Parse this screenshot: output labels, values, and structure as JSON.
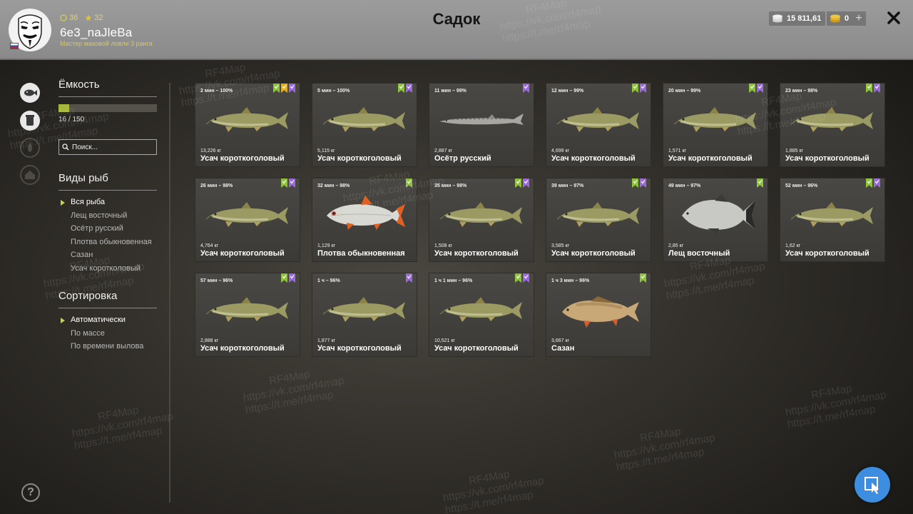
{
  "header": {
    "title": "Садок",
    "username": "6e3_naJleBa",
    "rank": "Мастер маховой ловли 3 ранга",
    "level": "36",
    "stars": "32",
    "silver": "15 811,61",
    "gold": "0",
    "plus_label": "+"
  },
  "side": {
    "capacity_title": "Ёмкость",
    "capacity_text": "16 / 150",
    "capacity_fraction": 0.107,
    "search_placeholder": "Поиск...",
    "species_title": "Виды рыб",
    "species": [
      "Вся рыба",
      "Лещ восточный",
      "Осётр русский",
      "Плотва обыкновенная",
      "Сазан",
      "Усач коротколовый"
    ],
    "sort_title": "Сортировка",
    "sort": [
      "Автоматически",
      "По массе",
      "По времени вылова"
    ],
    "help": "?"
  },
  "cards": [
    {
      "time": "2 мин – 100%",
      "weight": "13,226 кг",
      "name": "Усач короткоголовый",
      "fish": "barbel",
      "badges": [
        "green",
        "gold",
        "purple"
      ]
    },
    {
      "time": "5 мин – 100%",
      "weight": "5,115 кг",
      "name": "Усач короткоголовый",
      "fish": "barbel",
      "badges": [
        "green",
        "purple"
      ]
    },
    {
      "time": "11 мин – 99%",
      "weight": "2,887 кг",
      "name": "Осётр русский",
      "fish": "sturgeon",
      "badges": [
        "purple"
      ]
    },
    {
      "time": "12 мин – 99%",
      "weight": "4,699 кг",
      "name": "Усач короткоголовый",
      "fish": "barbel",
      "badges": [
        "green",
        "purple"
      ]
    },
    {
      "time": "20 мин – 99%",
      "weight": "1,571 кг",
      "name": "Усач короткоголовый",
      "fish": "barbel",
      "badges": [
        "green",
        "purple"
      ]
    },
    {
      "time": "23 мин – 98%",
      "weight": "1,885 кг",
      "name": "Усач короткоголовый",
      "fish": "barbel",
      "badges": [
        "green",
        "purple"
      ]
    },
    {
      "time": "26 мин – 98%",
      "weight": "4,764 кг",
      "name": "Усач короткоголовый",
      "fish": "barbel",
      "badges": [
        "green",
        "purple"
      ]
    },
    {
      "time": "32 мин – 98%",
      "weight": "1,129 кг",
      "name": "Плотва обыкновенная",
      "fish": "roach",
      "badges": [
        "green"
      ]
    },
    {
      "time": "35 мин – 98%",
      "weight": "1,508 кг",
      "name": "Усач короткоголовый",
      "fish": "barbel",
      "badges": [
        "green",
        "purple"
      ]
    },
    {
      "time": "39 мин – 97%",
      "weight": "3,585 кг",
      "name": "Усач короткоголовый",
      "fish": "barbel",
      "badges": [
        "green",
        "purple"
      ]
    },
    {
      "time": "49 мин – 97%",
      "weight": "2,85 кг",
      "name": "Лещ восточный",
      "fish": "bream",
      "badges": [
        "green"
      ]
    },
    {
      "time": "52 мин – 96%",
      "weight": "1,62 кг",
      "name": "Усач короткоголовый",
      "fish": "barbel",
      "badges": [
        "green",
        "purple"
      ]
    },
    {
      "time": "57 мин – 96%",
      "weight": "2,888 кг",
      "name": "Усач короткоголовый",
      "fish": "barbel",
      "badges": [
        "green",
        "purple"
      ]
    },
    {
      "time": "1 ч – 96%",
      "weight": "1,877 кг",
      "name": "Усач короткоголовый",
      "fish": "barbel",
      "badges": [
        "purple"
      ]
    },
    {
      "time": "1 ч 1 мин – 96%",
      "weight": "10,521 кг",
      "name": "Усач короткоголовый",
      "fish": "barbel",
      "badges": [
        "green",
        "purple"
      ]
    },
    {
      "time": "1 ч 3 мин – 96%",
      "weight": "3,667 кг",
      "name": "Сазан",
      "fish": "carp",
      "badges": [
        "green"
      ]
    }
  ],
  "watermark": {
    "brand": "RF4Map",
    "vk": "https://vk.com/rf4map",
    "tg": "https://t.me/rf4map"
  },
  "colors": {
    "badge_green": "#8fc23c",
    "badge_gold": "#e0b020",
    "badge_purple": "#9a6ad8",
    "accent": "#a6b83a",
    "cursor_button": "#3d8ee0"
  }
}
